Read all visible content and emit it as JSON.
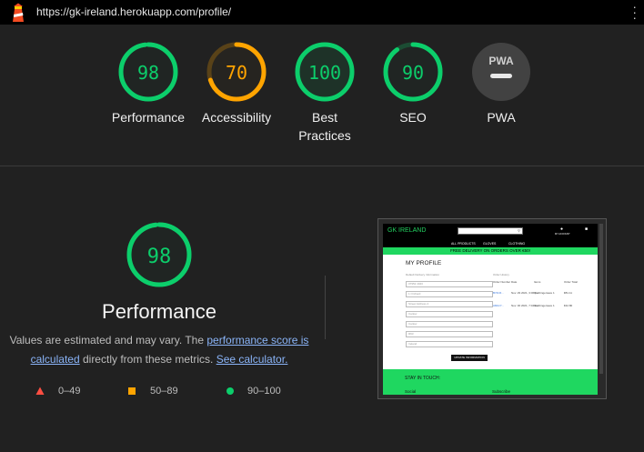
{
  "browser": {
    "url": "https://gk-ireland.herokuapp.com/profile/"
  },
  "colors": {
    "pass": "#0cce6b",
    "average": "#ffa400",
    "fail": "#ff4e42",
    "neutral": "#9e9e9e"
  },
  "scores": [
    {
      "name": "performance",
      "value": 98,
      "label": "Performance",
      "status": "pass"
    },
    {
      "name": "accessibility",
      "value": 70,
      "label": "Accessibility",
      "status": "average"
    },
    {
      "name": "best-practices",
      "value": 100,
      "label_line1": "Best",
      "label_line2": "Practices",
      "status": "pass"
    },
    {
      "name": "seo",
      "value": 90,
      "label": "SEO",
      "status": "pass"
    },
    {
      "name": "pwa",
      "badge": "PWA",
      "label": "PWA",
      "status": "neutral"
    }
  ],
  "detail": {
    "score": 98,
    "title": "Performance",
    "desc_before": "Values are estimated and may vary. The ",
    "link_score": "performance score is calculated",
    "desc_middle": " directly from these metrics. ",
    "link_calc": "See calculator."
  },
  "legend": [
    {
      "icon": "triangle-icon",
      "range": "0–49"
    },
    {
      "icon": "square-icon",
      "range": "50–89"
    },
    {
      "icon": "circle-icon",
      "range": "90–100"
    }
  ],
  "screenshot": {
    "brand": "GK IRELAND",
    "menu": [
      "ALL PRODUCTS",
      "GLOVES",
      "CLOTHING"
    ],
    "account": "MY ACCOUNT",
    "banner": "FREE DELIVERY ON ORDERS OVER €50!",
    "profile_title": "MY PROFILE",
    "delivery_heading": "Default Delivery Information",
    "order_heading": "Order History",
    "fields": [
      "07952 4943",
      "1 Orchard",
      "Street Address 2",
      "Carlow",
      "Carlow",
      "R93",
      "Ireland"
    ],
    "order_cols": [
      "Order Number",
      "Date",
      "Items",
      "Order Total"
    ],
    "orders": [
      {
        "number": "B74C6...",
        "date": "Nov. 29 2021, 3:06 p.m.",
        "items": "Rio Fingersave 1",
        "total": "€81.11"
      },
      {
        "number": "A8AC7...",
        "date": "Nov. 30 2021, 7:04 a.m.",
        "items": "Rio Fingersave 1",
        "total": "€42.80"
      }
    ],
    "update_button": "UPDATE INFORMATION",
    "footer_heading": "STAY IN TOUCH:",
    "footer_social": "Social",
    "footer_subscribe": "Subscribe"
  }
}
